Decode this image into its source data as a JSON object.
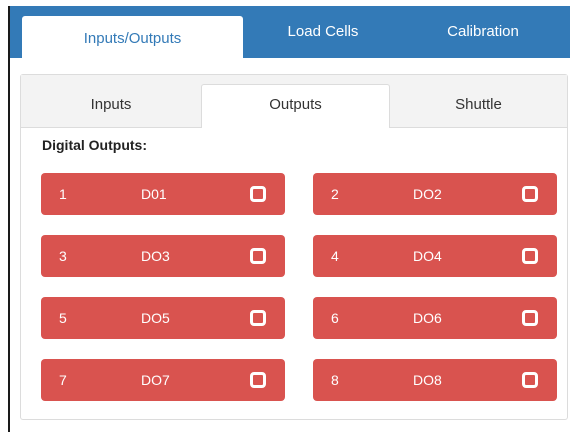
{
  "top_tabs": [
    {
      "label": "Inputs/Outputs",
      "active": true
    },
    {
      "label": "Load Cells",
      "active": false
    },
    {
      "label": "Calibration",
      "active": false
    }
  ],
  "sub_tabs": [
    {
      "label": "Inputs",
      "active": false
    },
    {
      "label": "Outputs",
      "active": true
    },
    {
      "label": "Shuttle",
      "active": false
    }
  ],
  "section_title": "Digital Outputs:",
  "outputs": [
    {
      "num": "1",
      "name": "D01",
      "state_icon": "square-outline-icon"
    },
    {
      "num": "2",
      "name": "DO2",
      "state_icon": "square-outline-icon"
    },
    {
      "num": "3",
      "name": "DO3",
      "state_icon": "square-outline-icon"
    },
    {
      "num": "4",
      "name": "DO4",
      "state_icon": "square-outline-icon"
    },
    {
      "num": "5",
      "name": "DO5",
      "state_icon": "square-outline-icon"
    },
    {
      "num": "6",
      "name": "DO6",
      "state_icon": "square-outline-icon"
    },
    {
      "num": "7",
      "name": "DO7",
      "state_icon": "square-outline-icon"
    },
    {
      "num": "8",
      "name": "DO8",
      "state_icon": "square-outline-icon"
    }
  ],
  "colors": {
    "primary": "#337ab7",
    "danger": "#d9534f"
  }
}
